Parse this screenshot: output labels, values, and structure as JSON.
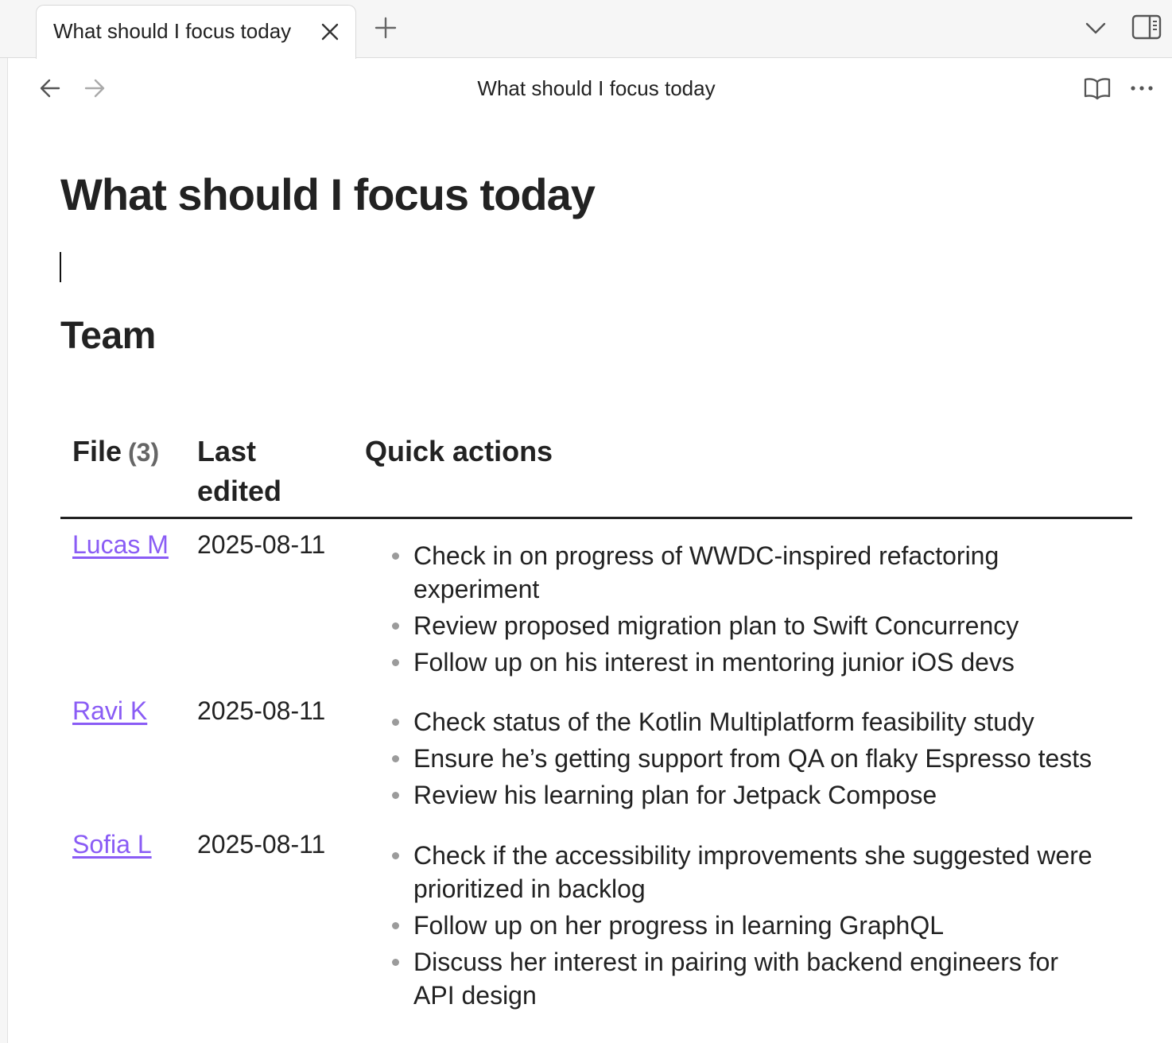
{
  "tab": {
    "title": "What should I focus today"
  },
  "view_header": {
    "title": "What should I focus today"
  },
  "note": {
    "title": "What should I focus today",
    "section_heading": "Team"
  },
  "table": {
    "headers": {
      "file": "File",
      "file_count": "(3)",
      "last_edited": "Last edited",
      "quick_actions": "Quick actions"
    },
    "rows": [
      {
        "file": "Lucas M",
        "last_edited": "2025-08-11",
        "actions": [
          "Check in on progress of WWDC-inspired refactoring experiment",
          "Review proposed migration plan to Swift Concurrency",
          "Follow up on his interest in mentoring junior iOS devs"
        ]
      },
      {
        "file": "Ravi K",
        "last_edited": "2025-08-11",
        "actions": [
          "Check status of the Kotlin Multiplatform feasibility study",
          "Ensure he’s getting support from QA on flaky Espresso tests",
          "Review his learning plan for Jetpack Compose"
        ]
      },
      {
        "file": "Sofia L",
        "last_edited": "2025-08-11",
        "actions": [
          "Check if the accessibility improvements she suggested were prioritized in backlog",
          "Follow up on her progress in learning GraphQL",
          "Discuss her interest in pairing with backend engineers for API design"
        ]
      }
    ]
  },
  "icons": {
    "tab_close": "close-icon",
    "new_tab": "plus-icon",
    "tab_list": "chevron-down-icon",
    "sidebar_toggle": "sidebar-toggle-icon",
    "back": "arrow-left-icon",
    "forward": "arrow-right-icon",
    "reading_view": "book-open-icon",
    "more": "more-horizontal-icon"
  },
  "colors": {
    "link": "#8a5cf5",
    "text": "#222222",
    "chrome_bg": "#f6f6f6"
  }
}
